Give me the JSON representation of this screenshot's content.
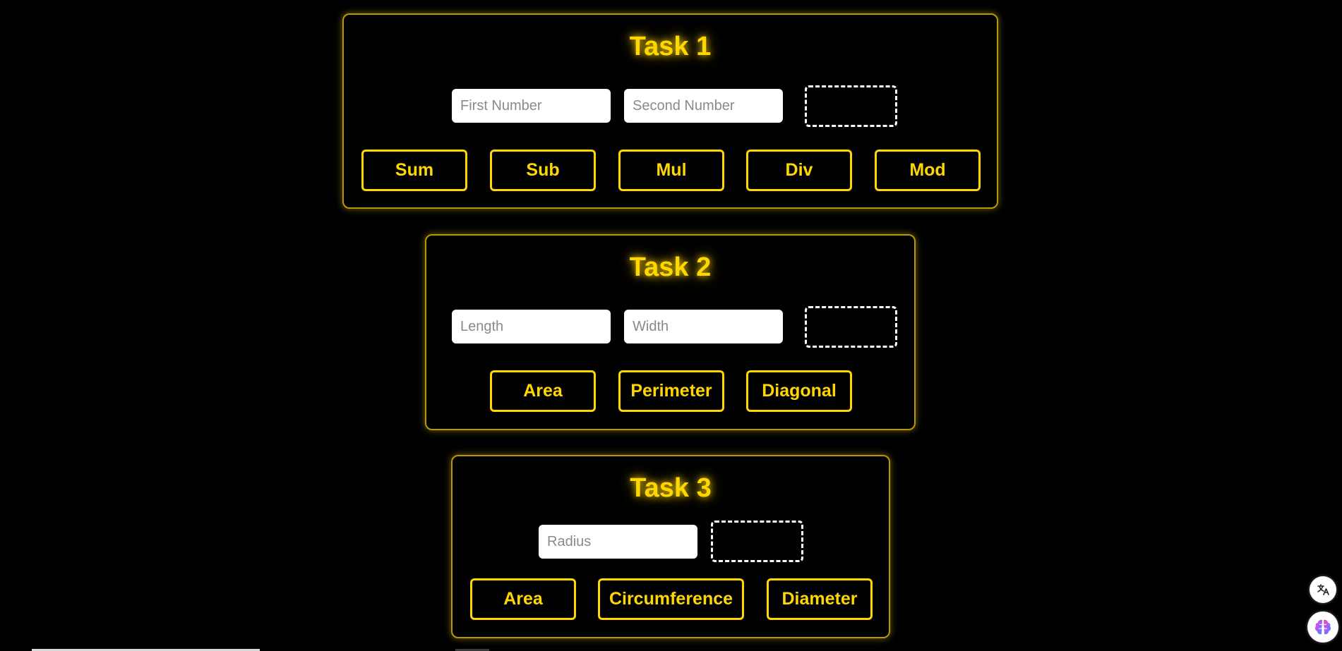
{
  "task1": {
    "title": "Task 1",
    "first_placeholder": "First Number",
    "second_placeholder": "Second Number",
    "result": "",
    "buttons": [
      "Sum",
      "Sub",
      "Mul",
      "Div",
      "Mod"
    ]
  },
  "task2": {
    "title": "Task 2",
    "length_placeholder": "Length",
    "width_placeholder": "Width",
    "result": "",
    "buttons": [
      "Area",
      "Perimeter",
      "Diagonal"
    ]
  },
  "task3": {
    "title": "Task 3",
    "radius_placeholder": "Radius",
    "result": "",
    "buttons": [
      "Area",
      "Circumference",
      "Diameter"
    ]
  },
  "floating": {
    "translate_icon": "translate-icon",
    "brain_icon": "brain-icon"
  },
  "colors": {
    "accent": "#ffd700",
    "background": "#000000",
    "card_border": "#b8960a"
  }
}
